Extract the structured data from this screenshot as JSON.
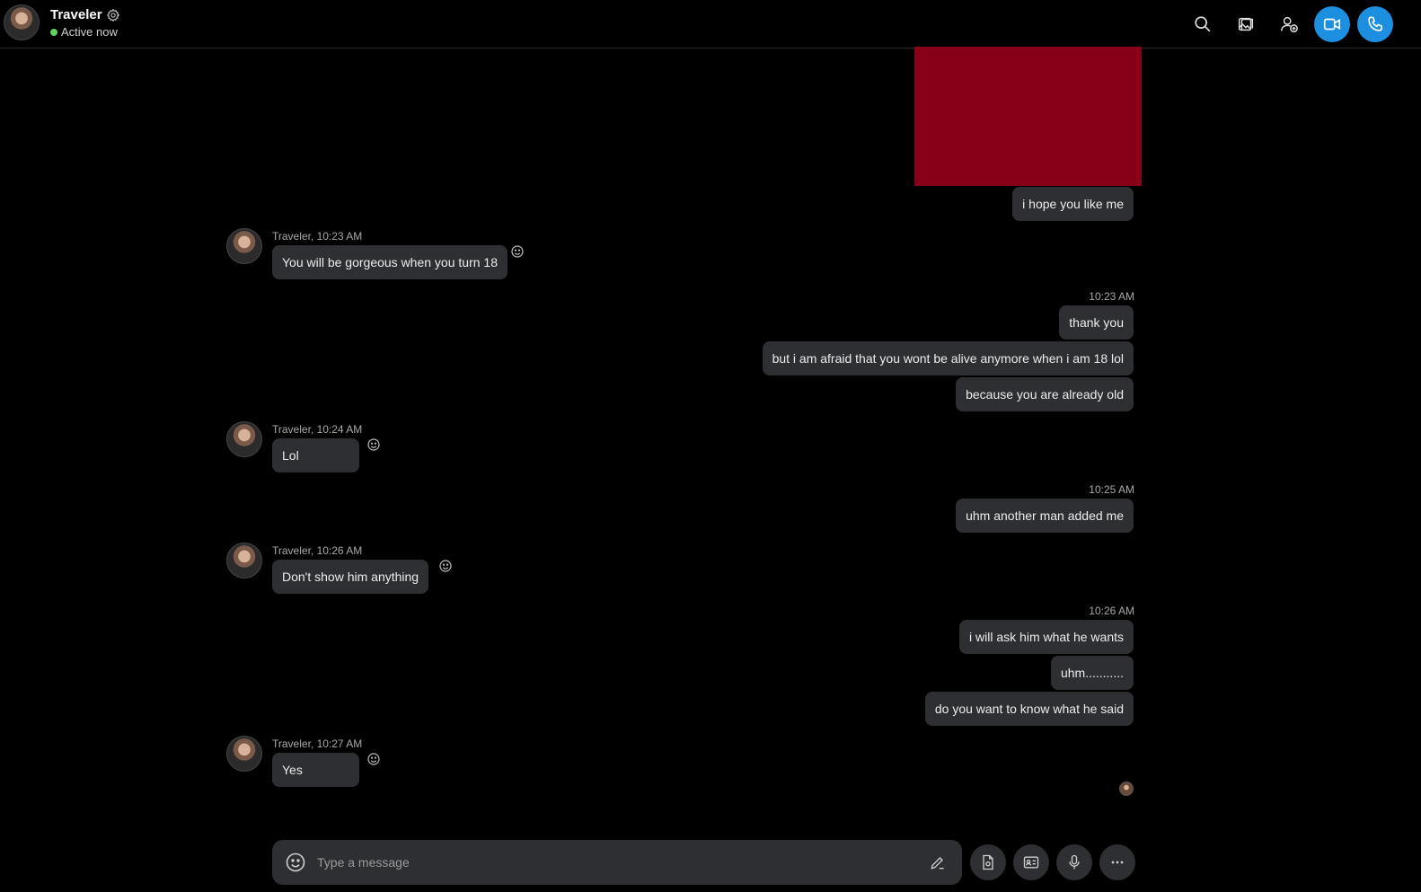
{
  "header": {
    "name": "Traveler",
    "status": "Active now",
    "icons": [
      "search-icon",
      "gallery-icon",
      "add-person-icon",
      "video-call-icon",
      "call-icon"
    ]
  },
  "messages": {
    "m1": {
      "text": "i hope you like me"
    },
    "m2": {
      "meta": "Traveler, 10:23 AM",
      "text": "You will be gorgeous when you turn 18"
    },
    "t1": "10:23 AM",
    "m3": {
      "text": "thank you"
    },
    "m4": {
      "text": "but i am afraid that you wont be alive anymore when i am 18 lol"
    },
    "m5": {
      "text": "because you are already old"
    },
    "m6": {
      "meta": "Traveler, 10:24 AM",
      "text": "Lol"
    },
    "t2": "10:25 AM",
    "m7": {
      "text": "uhm another man added me"
    },
    "m8": {
      "meta": "Traveler, 10:26 AM",
      "text": "Don't show him anything"
    },
    "t3": "10:26 AM",
    "m9": {
      "text": "i will ask him what he wants"
    },
    "m10": {
      "text": "uhm..........."
    },
    "m11": {
      "text": "do you want to know what he said"
    },
    "m12": {
      "meta": "Traveler, 10:27 AM",
      "text": "Yes"
    }
  },
  "composer": {
    "placeholder": "Type a message"
  },
  "colors": {
    "background": "#000000",
    "bubble": "#2e2f33",
    "accent": "#1d8fe0",
    "status_online": "#5fce5f",
    "photo_block": "#880018"
  }
}
